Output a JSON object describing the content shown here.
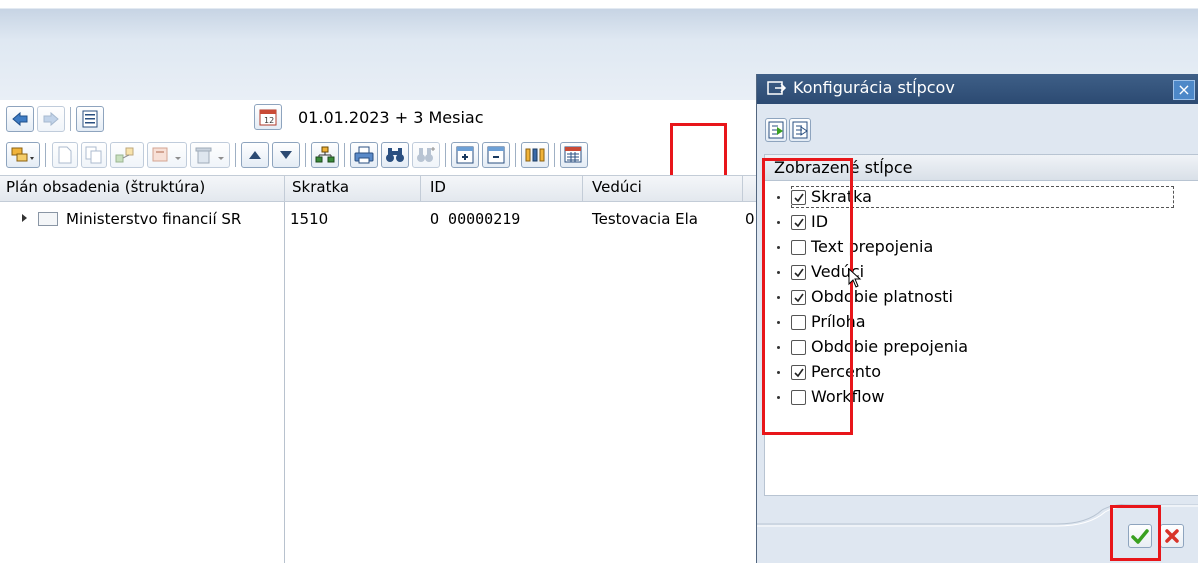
{
  "toolbar": {
    "date_range": "01.01.2023 + 3 Mesiac"
  },
  "table": {
    "headers": [
      "Plán obsadenia (štruktúra)",
      "Skratka",
      "ID",
      "Vedúci",
      ""
    ],
    "row": {
      "name": "Ministerstvo financií SR",
      "skratka": "1510",
      "id": "O 00000219",
      "veduci": "Testovacia Ela",
      "extra": "0"
    }
  },
  "dialog": {
    "title": "Konfigurácia stĺpcov",
    "list_header": "Zobrazené stĺpce",
    "columns": [
      {
        "label": "Skratka",
        "checked": true
      },
      {
        "label": "ID",
        "checked": true
      },
      {
        "label": "Text prepojenia",
        "checked": false
      },
      {
        "label": "Vedúci",
        "checked": true
      },
      {
        "label": "Obdobie platnosti",
        "checked": true
      },
      {
        "label": "Príloha",
        "checked": false
      },
      {
        "label": "Obdobie prepojenia",
        "checked": false
      },
      {
        "label": "Percento",
        "checked": true
      },
      {
        "label": "Workflow",
        "checked": false
      }
    ],
    "close_glyph": "×"
  },
  "colors": {
    "highlight": "#e8161a",
    "title_bar": "#2c4a72",
    "confirm": "#3aa020",
    "cancel": "#d8342a"
  }
}
